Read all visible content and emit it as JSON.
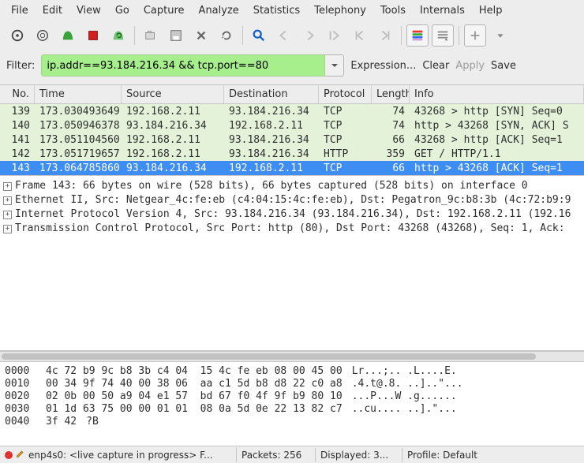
{
  "menubar": [
    "File",
    "Edit",
    "View",
    "Go",
    "Capture",
    "Analyze",
    "Statistics",
    "Telephony",
    "Tools",
    "Internals",
    "Help"
  ],
  "toolbar_icons": [
    "interfaces-icon",
    "options-icon",
    "start-capture-icon",
    "stop-capture-icon",
    "restart-capture-icon",
    "SEP",
    "open-icon",
    "save-icon",
    "close-icon",
    "reload-icon",
    "SEP",
    "find-icon",
    "go-back-icon",
    "go-forward-icon",
    "go-to-icon",
    "first-icon",
    "last-icon",
    "SEP",
    "colorize-icon",
    "auto-scroll-icon",
    "SEP",
    "zoom-in-icon",
    "zoom-drop-icon"
  ],
  "filter": {
    "label": "Filter:",
    "value": "ip.addr==93.184.216.34 && tcp.port==80",
    "expression": "Expression...",
    "clear": "Clear",
    "apply": "Apply",
    "save": "Save"
  },
  "packet_list": {
    "headers": [
      "No.",
      "Time",
      "Source",
      "Destination",
      "Protocol",
      "Length",
      "Info"
    ],
    "rows": [
      {
        "no": "139",
        "time": "173.030493649",
        "src": "192.168.2.11",
        "dst": "93.184.216.34",
        "proto": "TCP",
        "len": "74",
        "info": "43268 > http [SYN] Seq=0",
        "cls": "row-green"
      },
      {
        "no": "140",
        "time": "173.050946378",
        "src": "93.184.216.34",
        "dst": "192.168.2.11",
        "proto": "TCP",
        "len": "74",
        "info": "http > 43268 [SYN, ACK] S",
        "cls": "row-green"
      },
      {
        "no": "141",
        "time": "173.051104560",
        "src": "192.168.2.11",
        "dst": "93.184.216.34",
        "proto": "TCP",
        "len": "66",
        "info": "43268 > http [ACK] Seq=1",
        "cls": "row-green"
      },
      {
        "no": "142",
        "time": "173.051719657",
        "src": "192.168.2.11",
        "dst": "93.184.216.34",
        "proto": "HTTP",
        "len": "359",
        "info": "GET / HTTP/1.1",
        "cls": "row-green"
      },
      {
        "no": "143",
        "time": "173.064785860",
        "src": "93.184.216.34",
        "dst": "192.168.2.11",
        "proto": "TCP",
        "len": "66",
        "info": "http > 43268 [ACK] Seq=1",
        "cls": "row-sel"
      }
    ]
  },
  "details": [
    "Frame 143: 66 bytes on wire (528 bits), 66 bytes captured (528 bits) on interface 0",
    "Ethernet II, Src: Netgear_4c:fe:eb (c4:04:15:4c:fe:eb), Dst: Pegatron_9c:b8:3b (4c:72:b9:9",
    "Internet Protocol Version 4, Src: 93.184.216.34 (93.184.216.34), Dst: 192.168.2.11 (192.16",
    "Transmission Control Protocol, Src Port: http (80), Dst Port: 43268 (43268), Seq: 1, Ack:"
  ],
  "hex": {
    "rows": [
      {
        "off": "0000",
        "bytes": "4c 72 b9 9c b8 3b c4 04  15 4c fe eb 08 00 45 00",
        "ascii": "Lr...;.. .L....E."
      },
      {
        "off": "0010",
        "bytes": "00 34 9f 74 40 00 38 06  aa c1 5d b8 d8 22 c0 a8",
        "ascii": ".4.t@.8. ..]..\"..."
      },
      {
        "off": "0020",
        "bytes": "02 0b 00 50 a9 04 e1 57  bd 67 f0 4f 9f b9 80 10",
        "ascii": "...P...W .g......"
      },
      {
        "off": "0030",
        "bytes": "01 1d 63 75 00 00 01 01  08 0a 5d 0e 22 13 82 c7",
        "ascii": "..cu.... ..].\"..."
      },
      {
        "off": "0040",
        "bytes": "3f 42",
        "ascii": "?B"
      }
    ]
  },
  "statusbar": {
    "interface": "enp4s0: <live capture in progress> F...",
    "packets": "Packets: 256",
    "displayed": "Displayed: 3...",
    "profile": "Profile: Default"
  }
}
